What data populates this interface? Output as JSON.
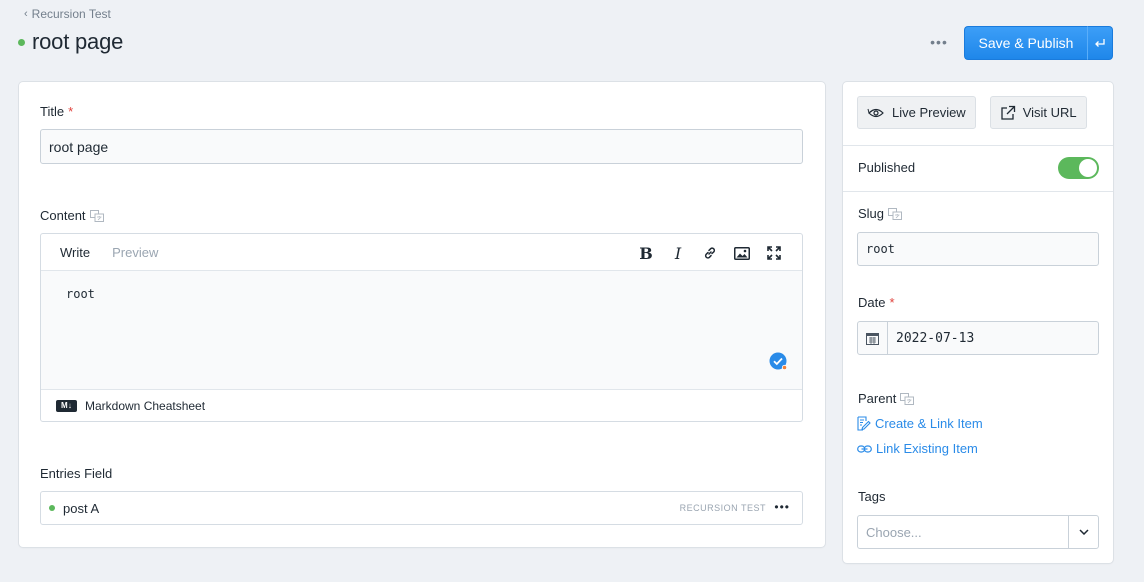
{
  "header": {
    "breadcrumb": "Recursion Test",
    "title": "root page",
    "more_label": "•••",
    "publish_label": "Save & Publish",
    "status_color": "#5cb85c",
    "accent": "#2a8be8"
  },
  "fields": {
    "title": {
      "label": "Title",
      "required": "*",
      "value": "root page"
    },
    "content": {
      "label": "Content",
      "tabs": [
        "Write",
        "Preview"
      ],
      "tools": [
        "bold-icon",
        "italic-icon",
        "link-icon",
        "image-icon",
        "fullscreen-icon"
      ],
      "value": "root",
      "footer": "Markdown Cheatsheet",
      "md_badge": "M↓"
    },
    "entries": {
      "label": "Entries Field",
      "items": [
        {
          "title": "post A",
          "collection": "RECURSION TEST",
          "more": "•••"
        }
      ]
    }
  },
  "sidebar": {
    "live_preview": "Live Preview",
    "visit_url": "Visit URL",
    "published_label": "Published",
    "published": true,
    "slug": {
      "label": "Slug",
      "value": "root"
    },
    "date": {
      "label": "Date",
      "required": "*",
      "value": "2022-07-13"
    },
    "parent": {
      "label": "Parent",
      "create_link": "Create & Link Item",
      "link_existing": "Link Existing Item"
    },
    "tags": {
      "label": "Tags",
      "placeholder": "Choose..."
    }
  }
}
